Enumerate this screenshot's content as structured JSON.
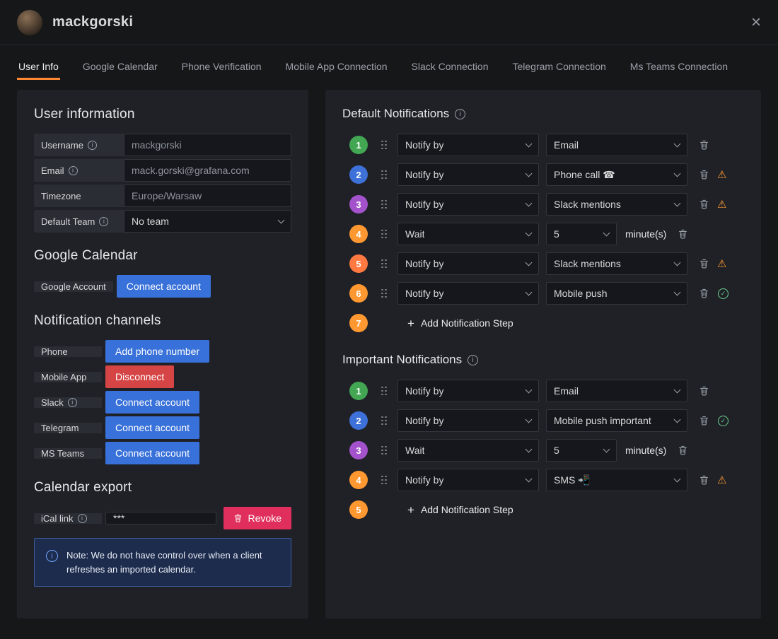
{
  "colors": {
    "accent_orange": "#ff8833",
    "primary_button": "#3871d9",
    "danger_button": "#d64545",
    "revoke_button": "#e02f5c",
    "warning_icon": "#ff9830",
    "success_icon": "#6ccf8e",
    "badge_green": "#43a653",
    "badge_blue": "#3d71d9",
    "badge_purple": "#a352cc",
    "badge_orange": "#ff9830",
    "badge_deep_orange": "#ff7941"
  },
  "header": {
    "title": "mackgorski"
  },
  "tabs": [
    {
      "label": "User Info"
    },
    {
      "label": "Google Calendar"
    },
    {
      "label": "Phone Verification"
    },
    {
      "label": "Mobile App Connection"
    },
    {
      "label": "Slack Connection"
    },
    {
      "label": "Telegram Connection"
    },
    {
      "label": "Ms Teams Connection"
    }
  ],
  "user_info": {
    "heading": "User information",
    "fields": {
      "username": {
        "label": "Username",
        "value": "mackgorski"
      },
      "email": {
        "label": "Email",
        "value": "mack.gorski@grafana.com"
      },
      "timezone": {
        "label": "Timezone",
        "value": "Europe/Warsaw"
      },
      "team": {
        "label": "Default Team",
        "value": "No team"
      }
    }
  },
  "google_calendar": {
    "heading": "Google Calendar",
    "account_label": "Google Account",
    "connect_button": "Connect account"
  },
  "channels": {
    "heading": "Notification channels",
    "phone": {
      "label": "Phone",
      "button": "Add phone number"
    },
    "mobile_app": {
      "label": "Mobile App",
      "button": "Disconnect"
    },
    "slack": {
      "label": "Slack",
      "button": "Connect account"
    },
    "telegram": {
      "label": "Telegram",
      "button": "Connect account"
    },
    "ms_teams": {
      "label": "MS Teams",
      "button": "Connect account"
    }
  },
  "calendar_export": {
    "heading": "Calendar export",
    "ical_label": "iCal link",
    "ical_value": "***",
    "revoke_button": "Revoke",
    "note": "Note: We do not have control over when a client refreshes an imported calendar."
  },
  "default_notifications": {
    "heading": "Default Notifications",
    "steps": [
      {
        "num": "1",
        "color": "#43a653",
        "action": "Notify by",
        "channel": "Email"
      },
      {
        "num": "2",
        "color": "#3d71d9",
        "action": "Notify by",
        "channel": "Phone call ☎"
      },
      {
        "num": "3",
        "color": "#a352cc",
        "action": "Notify by",
        "channel": "Slack mentions"
      },
      {
        "num": "4",
        "color": "#ff9830",
        "action": "Wait",
        "channel": "5",
        "suffix": "minute(s)"
      },
      {
        "num": "5",
        "color": "#ff7941",
        "action": "Notify by",
        "channel": "Slack mentions"
      },
      {
        "num": "6",
        "color": "#ff9830",
        "action": "Notify by",
        "channel": "Mobile push"
      }
    ],
    "add_step": {
      "num": "7",
      "color": "#ff9830",
      "label": "Add Notification Step"
    }
  },
  "important_notifications": {
    "heading": "Important Notifications",
    "steps": [
      {
        "num": "1",
        "color": "#43a653",
        "action": "Notify by",
        "channel": "Email"
      },
      {
        "num": "2",
        "color": "#3d71d9",
        "action": "Notify by",
        "channel": "Mobile push important"
      },
      {
        "num": "3",
        "color": "#a352cc",
        "action": "Wait",
        "channel": "5",
        "suffix": "minute(s)"
      },
      {
        "num": "4",
        "color": "#ff9830",
        "action": "Notify by",
        "channel": "SMS 📲"
      }
    ],
    "add_step": {
      "num": "5",
      "color": "#ff9830",
      "label": "Add Notification Step"
    }
  }
}
